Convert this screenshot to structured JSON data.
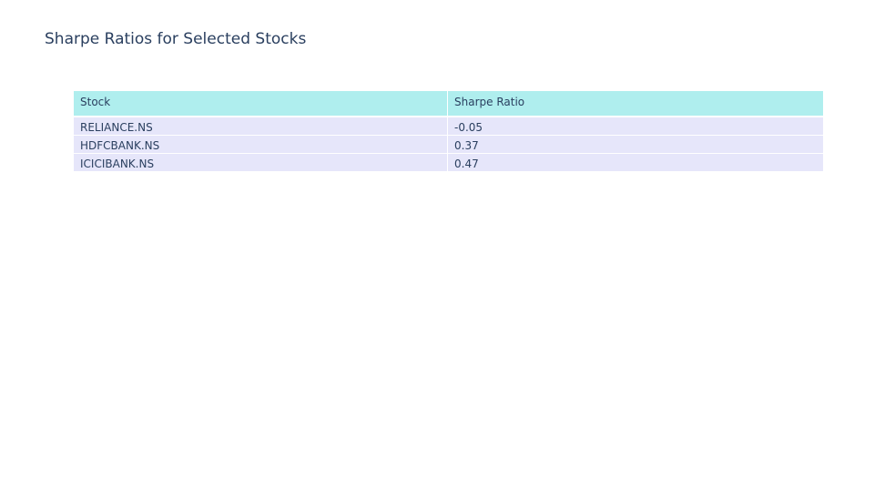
{
  "chart_data": {
    "type": "table",
    "title": "Sharpe Ratios for Selected Stocks",
    "columns": [
      "Stock",
      "Sharpe Ratio"
    ],
    "rows": [
      [
        "RELIANCE.NS",
        "-0.05"
      ],
      [
        "HDFCBANK.NS",
        "0.37"
      ],
      [
        "ICICIBANK.NS",
        "0.47"
      ]
    ],
    "colors": {
      "header_fill": "#afeeee",
      "cell_fill": "#e6e6fa",
      "text": "#2a3f5f"
    }
  }
}
